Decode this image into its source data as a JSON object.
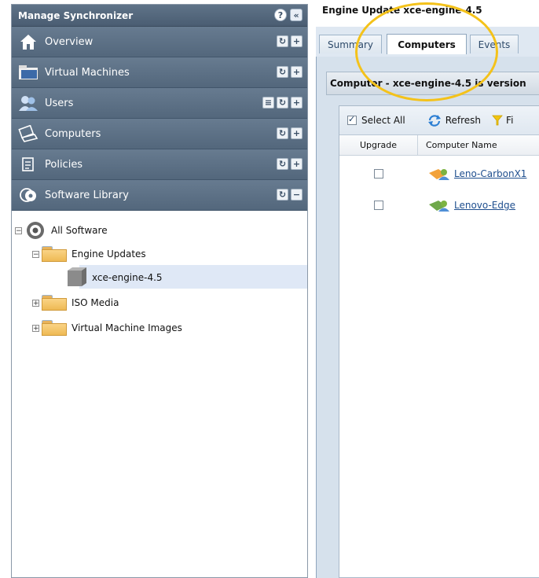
{
  "sidebar": {
    "title": "Manage Synchronizer",
    "header_buttons": [
      "?",
      "«"
    ],
    "nav": [
      {
        "label": "Overview",
        "icon": "home-icon",
        "buttons": [
          "refresh-icon",
          "add-icon"
        ]
      },
      {
        "label": "Virtual Machines",
        "icon": "folder-icon",
        "buttons": [
          "refresh-icon",
          "add-icon"
        ]
      },
      {
        "label": "Users",
        "icon": "users-icon",
        "buttons": [
          "list-icon",
          "refresh-icon",
          "add-icon"
        ]
      },
      {
        "label": "Computers",
        "icon": "computer-icon",
        "buttons": [
          "refresh-icon",
          "add-icon"
        ]
      },
      {
        "label": "Policies",
        "icon": "policy-icon",
        "buttons": [
          "refresh-icon",
          "add-icon"
        ]
      },
      {
        "label": "Software Library",
        "icon": "disc-icon",
        "buttons": [
          "refresh-icon",
          "collapse-icon"
        ]
      }
    ],
    "tree": {
      "root": "All Software",
      "engine_updates": "Engine Updates",
      "engine_item": "xce-engine-4.5",
      "iso_media": "ISO Media",
      "vm_images": "Virtual Machine Images"
    }
  },
  "panel": {
    "title": "Engine Update xce-engine-4.5",
    "tabs": [
      {
        "label": "Summary",
        "active": false
      },
      {
        "label": "Computers",
        "active": true
      },
      {
        "label": "Events",
        "active": false
      }
    ],
    "banner": "Computer - xce-engine-4.5 is version",
    "toolbar": {
      "select_all": "Select All",
      "refresh": "Refresh",
      "filter": "Fi"
    },
    "columns": [
      "Upgrade",
      "Computer Name"
    ],
    "rows": [
      {
        "name": "Leno-CarbonX1",
        "checked": false
      },
      {
        "name": "Lenovo-Edge",
        "checked": false
      }
    ]
  },
  "colors": {
    "sidebar_header": "#4a5d72",
    "nav_bg": "#5f7388",
    "highlight": "#f4c21a",
    "link": "#1f4f8f"
  }
}
